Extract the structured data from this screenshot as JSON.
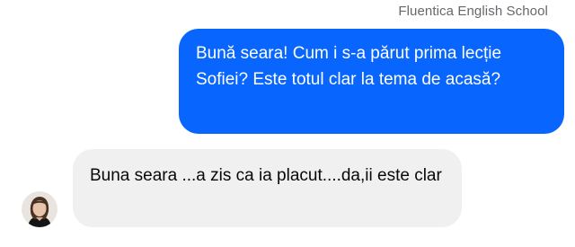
{
  "thread": {
    "sender_name": "Fluentica English School",
    "messages": [
      {
        "direction": "outgoing",
        "text": "Bună seara! Cum i s-a părut prima lecție Sofiei? Este totul clar la tema de acasă?"
      },
      {
        "direction": "incoming",
        "text": "Buna seara ...a zis ca ia placut....da,ii este clar"
      }
    ]
  },
  "colors": {
    "outgoing_bubble": "#0866ff",
    "incoming_bubble": "#f0f0f0",
    "sender_name": "#65676b"
  },
  "icons": {
    "contact_avatar": "avatar-photo"
  }
}
